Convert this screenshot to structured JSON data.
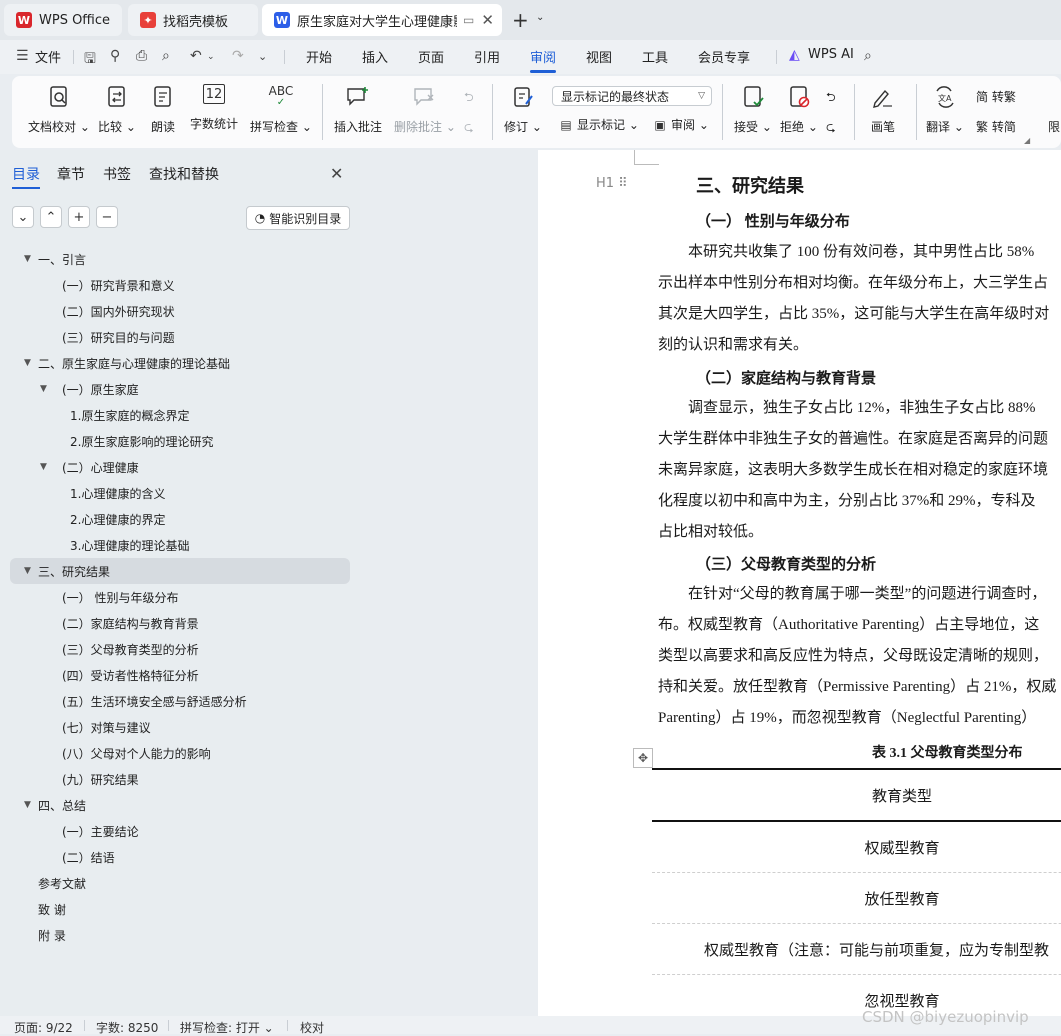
{
  "tabs": [
    {
      "label": "WPS Office",
      "color": "#d9262c"
    },
    {
      "label": "找稻壳模板",
      "color": "#e8403a"
    },
    {
      "label": "原生家庭对大学生心理健康影响",
      "color": "#2c5ee8"
    }
  ],
  "menu": [
    "文件",
    "开始",
    "插入",
    "页面",
    "引用",
    "审阅",
    "视图",
    "工具",
    "会员专享",
    "WPS AI"
  ],
  "ribbon": {
    "doc_check": "文档校对",
    "compare": "比较",
    "read_aloud": "朗读",
    "word_count": "字数统计",
    "word_count_icon_text": "12",
    "spell_check": "拼写检查",
    "spell_icon_text": "ABC",
    "insert_comment": "插入批注",
    "delete_comment": "删除批注",
    "revise": "修订",
    "markup_select": "显示标记的最终状态",
    "show_markup": "显示标记",
    "review": "审阅",
    "accept": "接受",
    "reject": "拒绝",
    "ink": "画笔",
    "translate": "翻译",
    "to_traditional": "简 转繁",
    "to_simplified": "繁 转简",
    "limit": "限"
  },
  "nav": {
    "tabs": [
      "目录",
      "章节",
      "书签",
      "查找和替换"
    ],
    "smart_button": "智能识别目录",
    "toc": [
      {
        "text": "一、引言",
        "level": 0,
        "arrow": true
      },
      {
        "text": "(一）研究背景和意义",
        "level": 1
      },
      {
        "text": "(二）国内外研究现状",
        "level": 1
      },
      {
        "text": "(三）研究目的与问题",
        "level": 1
      },
      {
        "text": "二、原生家庭与心理健康的理论基础",
        "level": 0,
        "arrow": true
      },
      {
        "text": "(一）原生家庭",
        "level": 1,
        "arrow": true
      },
      {
        "text": "1.原生家庭的概念界定",
        "level": 2
      },
      {
        "text": "2.原生家庭影响的理论研究",
        "level": 2
      },
      {
        "text": "(二）心理健康",
        "level": 1,
        "arrow": true
      },
      {
        "text": "1.心理健康的含义",
        "level": 2
      },
      {
        "text": "2.心理健康的界定",
        "level": 2
      },
      {
        "text": "3.心理健康的理论基础",
        "level": 2
      },
      {
        "text": "三、研究结果",
        "level": 0,
        "arrow": true,
        "selected": true
      },
      {
        "text": "(一）  性别与年级分布",
        "level": 1
      },
      {
        "text": "(二）家庭结构与教育背景",
        "level": 1
      },
      {
        "text": "(三）父母教育类型的分析",
        "level": 1
      },
      {
        "text": "(四）受访者性格特征分析",
        "level": 1
      },
      {
        "text": "(五）生活环境安全感与舒适感分析",
        "level": 1
      },
      {
        "text": "(七）对策与建议",
        "level": 1
      },
      {
        "text": "(八）父母对个人能力的影响",
        "level": 1
      },
      {
        "text": "(九）研究结果",
        "level": 1
      },
      {
        "text": "四、总结",
        "level": 0,
        "arrow": true
      },
      {
        "text": "(一）主要结论",
        "level": 1
      },
      {
        "text": "(二）结语",
        "level": 1
      },
      {
        "text": "参考文献",
        "level": 0
      },
      {
        "text": "致  谢",
        "level": 0
      },
      {
        "text": "附  录",
        "level": 0
      }
    ]
  },
  "doc": {
    "heading_marker": "H1",
    "h1": "三、研究结果",
    "s1_title": "（一）  性别与年级分布",
    "s1_lines": [
      "　　本研究共收集了 100 份有效问卷，其中男性占比 58%",
      "示出样本中性别分布相对均衡。在年级分布上，大三学生占",
      "其次是大四学生，占比 35%，这可能与大学生在高年级时对",
      "刻的认识和需求有关。"
    ],
    "s2_title": "（二）家庭结构与教育背景",
    "s2_lines": [
      "　　调查显示，独生子女占比 12%，非独生子女占比 88%",
      "大学生群体中非独生子女的普遍性。在家庭是否离异的问题",
      "未离异家庭，这表明大多数学生成长在相对稳定的家庭环境",
      "化程度以初中和高中为主，分别占比 37%和 29%，专科及",
      "占比相对较低。"
    ],
    "s3_title": "（三）父母教育类型的分析",
    "s3_lines": [
      "　　在针对“父母的教育属于哪一类型”的问题进行调查时，",
      "布。权威型教育（Authoritative Parenting）占主导地位，这",
      "类型以高要求和高反应性为特点，父母既设定清晰的规则，",
      "持和关爱。放任型教育（Permissive Parenting）占 21%，权威",
      "Parenting）占 19%，而忽视型教育（Neglectful Parenting）"
    ],
    "table_caption": "表 3.1  父母教育类型分布",
    "table_rows": [
      "教育类型",
      "权威型教育",
      "放任型教育",
      "权威型教育（注意：可能与前项重复，应为专制型教",
      "忽视型教育"
    ]
  },
  "status": {
    "page": "页面: 9/22",
    "words": "字数: 8250",
    "spell": "拼写检查: 打开",
    "proof": "校对"
  },
  "watermark": "CSDN @biyezuopinvip",
  "colors": {
    "accent": "#1f5fd6"
  }
}
